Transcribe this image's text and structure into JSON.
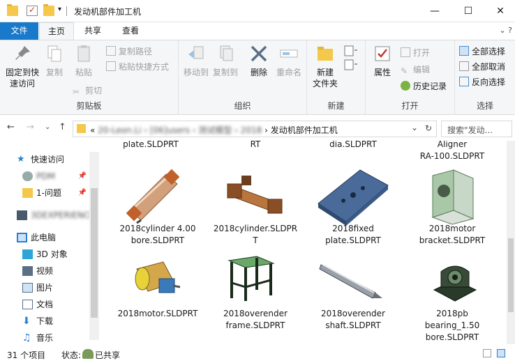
{
  "window": {
    "title": "发动机部件加工机",
    "minimize": "—",
    "maximize": "☐",
    "close": "✕"
  },
  "ribbon_tabs": {
    "file": "文件",
    "home": "主页",
    "share": "共享",
    "view": "查看",
    "expand": "⌄  ?"
  },
  "clipboard": {
    "pin": "固定到快\n速访问",
    "copy": "复制",
    "paste": "粘贴",
    "copy_path": "复制路径",
    "paste_shortcut": "粘贴快捷方式",
    "cut": "剪切",
    "label": "剪贴板"
  },
  "organize": {
    "move_to": "移动到",
    "copy_to": "复制到",
    "delete": "删除",
    "rename": "重命名",
    "label": "组织"
  },
  "new": {
    "new_folder": "新建\n文件夹",
    "label": "新建"
  },
  "open": {
    "properties": "属性",
    "open": "打开",
    "edit": "编辑",
    "history": "历史记录",
    "label": "打开"
  },
  "select": {
    "select_all": "全部选择",
    "select_none": "全部取消",
    "invert": "反向选择",
    "label": "选择"
  },
  "address": {
    "prefix": "«",
    "path_blurred": "20-Leon.Li › [06]users › 测试模型 › 2018",
    "current": "发动机部件加工机",
    "search_placeholder": "搜索\"发动..."
  },
  "leftnav": {
    "quick_access": "快速访问",
    "blurred_1": "PDM",
    "issues": "1-问题",
    "blurred_2": "3DEXPERIENCE",
    "this_pc": "此电脑",
    "objects3d": "3D 对象",
    "videos": "视频",
    "pictures": "图片",
    "documents": "文档",
    "downloads": "下载",
    "music": "音乐"
  },
  "files": {
    "row0": [
      "plate.SLDPRT",
      "RT",
      "dia.SLDPRT",
      "Aligner\nRA-100.SLDPRT"
    ],
    "row1": [
      "2018cylinder 4.00\nbore.SLDPRT",
      "2018cylinder.SLDPR\nT",
      "2018fixed\nplate.SLDPRT",
      "2018motor\nbracket.SLDPRT"
    ],
    "row2": [
      "2018motor.SLDPRT",
      "2018overender\nframe.SLDPRT",
      "2018overender\nshaft.SLDPRT",
      "2018pb\nbearing_1.50\nbore.SLDPRT"
    ]
  },
  "status": {
    "count": "31 个项目",
    "state_label": "状态:",
    "shared": "已共享"
  }
}
